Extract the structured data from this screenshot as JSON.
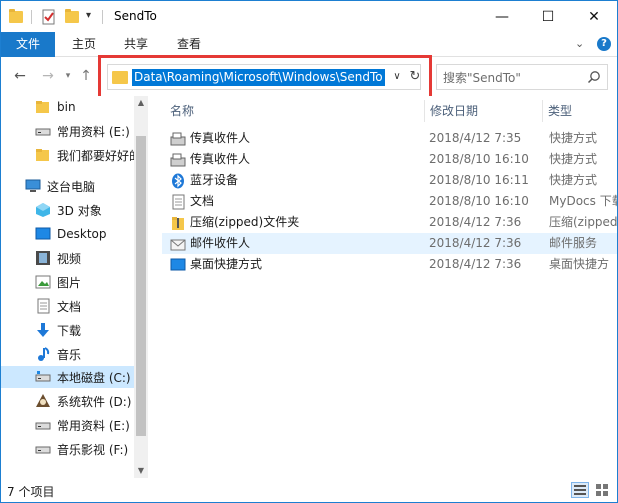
{
  "window": {
    "title": "SendTo",
    "controls": {
      "minimize": "—",
      "maximize": "☐",
      "close": "✕"
    }
  },
  "ribbon": {
    "tabs": [
      {
        "label": "文件"
      },
      {
        "label": "主页"
      },
      {
        "label": "共享"
      },
      {
        "label": "查看"
      }
    ]
  },
  "address": {
    "path": "Data\\Roaming\\Microsoft\\Windows\\SendTo"
  },
  "search": {
    "placeholder": "搜索\"SendTo\""
  },
  "nav": {
    "items": [
      {
        "label": "bin",
        "icon": "folder-icon"
      },
      {
        "label": "常用资料 (E:)",
        "icon": "drive-icon"
      },
      {
        "label": "我们都要好好的",
        "icon": "folder-icon"
      },
      {
        "label": "这台电脑",
        "icon": "computer-icon"
      },
      {
        "label": "3D 对象",
        "icon": "3d-objects-icon"
      },
      {
        "label": "Desktop",
        "icon": "desktop-icon"
      },
      {
        "label": "视频",
        "icon": "video-icon"
      },
      {
        "label": "图片",
        "icon": "pictures-icon"
      },
      {
        "label": "文档",
        "icon": "documents-icon"
      },
      {
        "label": "下载",
        "icon": "download-icon"
      },
      {
        "label": "音乐",
        "icon": "music-icon"
      },
      {
        "label": "本地磁盘 (C:)",
        "icon": "drive-icon"
      },
      {
        "label": "系统软件 (D:)",
        "icon": "custom-drive-icon"
      },
      {
        "label": "常用资料 (E:)",
        "icon": "drive-icon"
      },
      {
        "label": "音乐影视 (F:)",
        "icon": "drive-icon"
      }
    ]
  },
  "columns": {
    "name": "名称",
    "date": "修改日期",
    "type": "类型"
  },
  "files": [
    {
      "name": "传真收件人",
      "date": "2018/4/12 7:35",
      "type": "快捷方式",
      "icon": "fax-icon"
    },
    {
      "name": "传真收件人",
      "date": "2018/8/10 16:10",
      "type": "快捷方式",
      "icon": "fax-icon"
    },
    {
      "name": "蓝牙设备",
      "date": "2018/8/10 16:11",
      "type": "快捷方式",
      "icon": "bluetooth-icon"
    },
    {
      "name": "文档",
      "date": "2018/8/10 16:10",
      "type": "MyDocs 下载",
      "icon": "document-icon"
    },
    {
      "name": "压缩(zipped)文件夹",
      "date": "2018/4/12 7:36",
      "type": "压缩(zipped",
      "icon": "zip-folder-icon"
    },
    {
      "name": "邮件收件人",
      "date": "2018/4/12 7:36",
      "type": "邮件服务",
      "icon": "mail-icon"
    },
    {
      "name": "桌面快捷方式",
      "date": "2018/4/12 7:36",
      "type": "桌面快捷方",
      "icon": "desktop-shortcut-icon"
    }
  ],
  "status": {
    "count_text": "7 个项目"
  },
  "colors": {
    "accent": "#1979ca",
    "selection": "#0078d7",
    "nav_selected": "#cce8ff",
    "row_selected": "#e5f3ff",
    "highlight_box": "#e53935"
  }
}
